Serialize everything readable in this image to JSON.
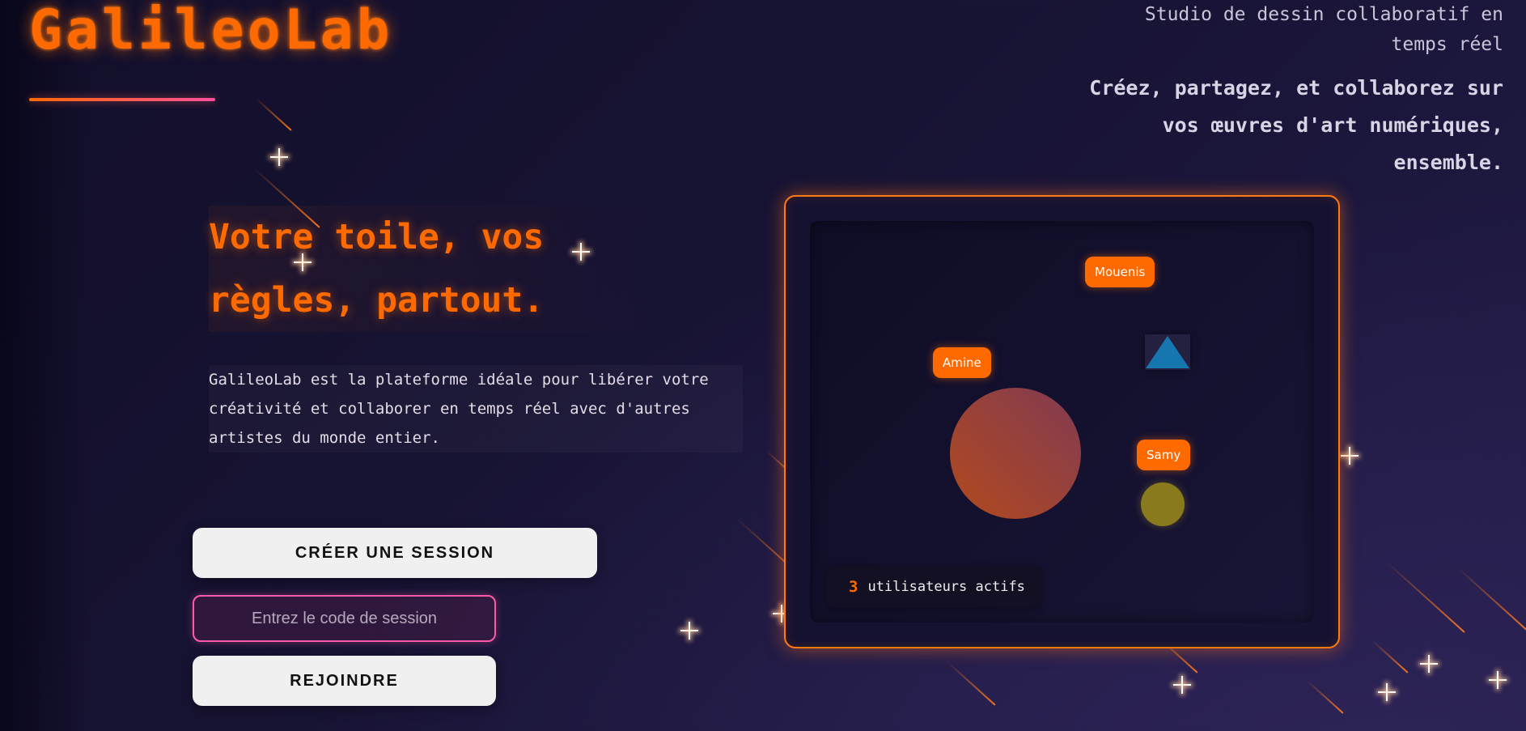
{
  "header": {
    "logo": "GalileoLab",
    "tagline": "Studio de dessin collaboratif en temps réel",
    "subtagline": "Créez, partagez, et collaborez sur vos œuvres d'art numériques, ensemble."
  },
  "hero": {
    "title": "Votre toile, vos règles, partout.",
    "description": "GalileoLab est la plateforme idéale pour libérer votre créativité et collaborer en temps réel avec d'autres artistes du monde entier."
  },
  "actions": {
    "create_label": "CRÉER UNE SESSION",
    "code_placeholder": "Entrez le code de session",
    "code_value": "",
    "join_label": "REJOINDRE"
  },
  "preview": {
    "users": [
      {
        "name": "Mouenis",
        "shape": "triangle"
      },
      {
        "name": "Amine",
        "shape": "circle"
      },
      {
        "name": "Samy",
        "shape": "circle"
      }
    ],
    "active_count": "3",
    "active_label": "utilisateurs actifs"
  },
  "colors": {
    "accent": "#ff6a00",
    "accent_pink": "#ff5aa8",
    "background": "#171333",
    "triangle": "#1676b0",
    "samy_circle": "#8a7a1e"
  }
}
